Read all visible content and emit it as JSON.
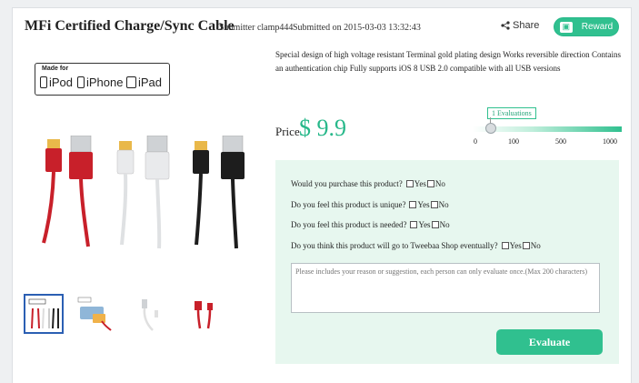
{
  "header": {
    "title": "MFi Certified Charge/Sync Cable",
    "submitter": "Submitter clamp444",
    "submitted_on": "Submitted on 2015-03-03 13:32:43",
    "share_label": "Share",
    "reward_label": "Reward"
  },
  "badge": {
    "made_for": "Made for",
    "devices": [
      "iPod",
      "iPhone",
      "iPad"
    ]
  },
  "description": "Special design of high voltage resistant Terminal gold plating design Works reversible direction Contains an authentication chip Fully supports iOS 8 USB 2.0 compatible with all USB versions",
  "price": {
    "label": "Price",
    "value": "$ 9.9"
  },
  "evaluation_scale": {
    "count_label": "1 Evaluations",
    "ticks": [
      "0",
      "100",
      "500",
      "1000"
    ]
  },
  "questions": [
    {
      "text": "Would you purchase this product?",
      "yes": "Yes",
      "no": "No"
    },
    {
      "text": "Do you feel this product is unique?",
      "yes": "Yes",
      "no": "No"
    },
    {
      "text": "Do you feel this product is needed?",
      "yes": "Yes",
      "no": "No"
    },
    {
      "text": "Do you think this product will go to Tweebaa Shop eventually?",
      "yes": "Yes",
      "no": "No"
    }
  ],
  "reason_placeholder": "Please includes your reason or suggestion, each person can only evaluate once.(Max 200 characters)",
  "evaluate_label": "Evaluate",
  "colors": {
    "accent": "#30c08f",
    "panel": "#e7f7ef",
    "cable_red": "#c8202a",
    "cable_white": "#e9eaec",
    "cable_black": "#1d1d1d",
    "thumb_border": "#2b5fb3"
  }
}
